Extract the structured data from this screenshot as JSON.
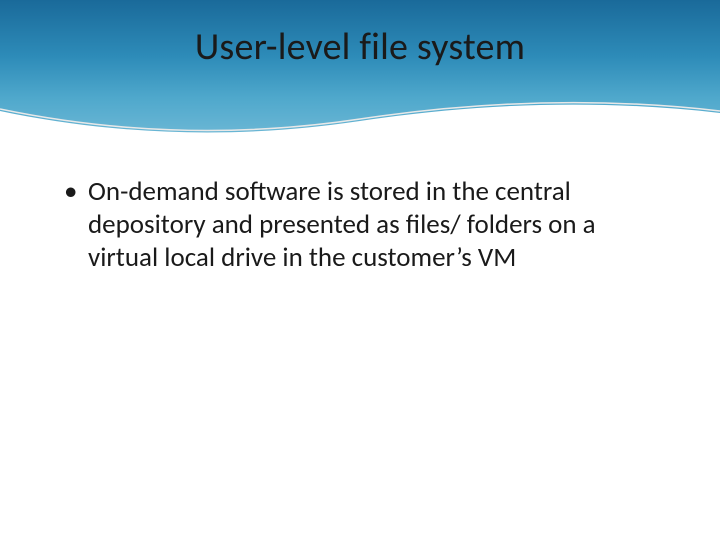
{
  "slide": {
    "title": "User-level file system",
    "bullets": [
      "On-demand software is stored in the central depository and presented as files/ folders on a virtual local drive in the customer’s VM"
    ]
  }
}
